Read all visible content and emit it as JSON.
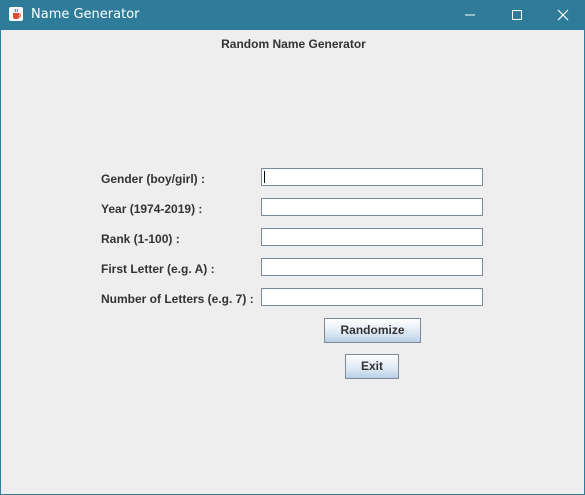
{
  "window": {
    "title": "Name Generator",
    "app_icon": "java-cup-icon",
    "controls": [
      "minimize-icon",
      "maximize-icon",
      "close-icon"
    ]
  },
  "main": {
    "heading": "Random Name Generator",
    "fields": [
      {
        "label": "Gender (boy/girl) :",
        "value": ""
      },
      {
        "label": "Year (1974-2019) :",
        "value": ""
      },
      {
        "label": "Rank (1-100) :",
        "value": ""
      },
      {
        "label": "First Letter (e.g. A) :",
        "value": ""
      },
      {
        "label": "Number of Letters (e.g. 7) :",
        "value": ""
      }
    ],
    "randomize_label": "Randomize",
    "exit_label": "Exit"
  },
  "colors": {
    "titlebar": "#2e7c9a",
    "content_bg": "#eeeeee",
    "text": "#333333"
  }
}
